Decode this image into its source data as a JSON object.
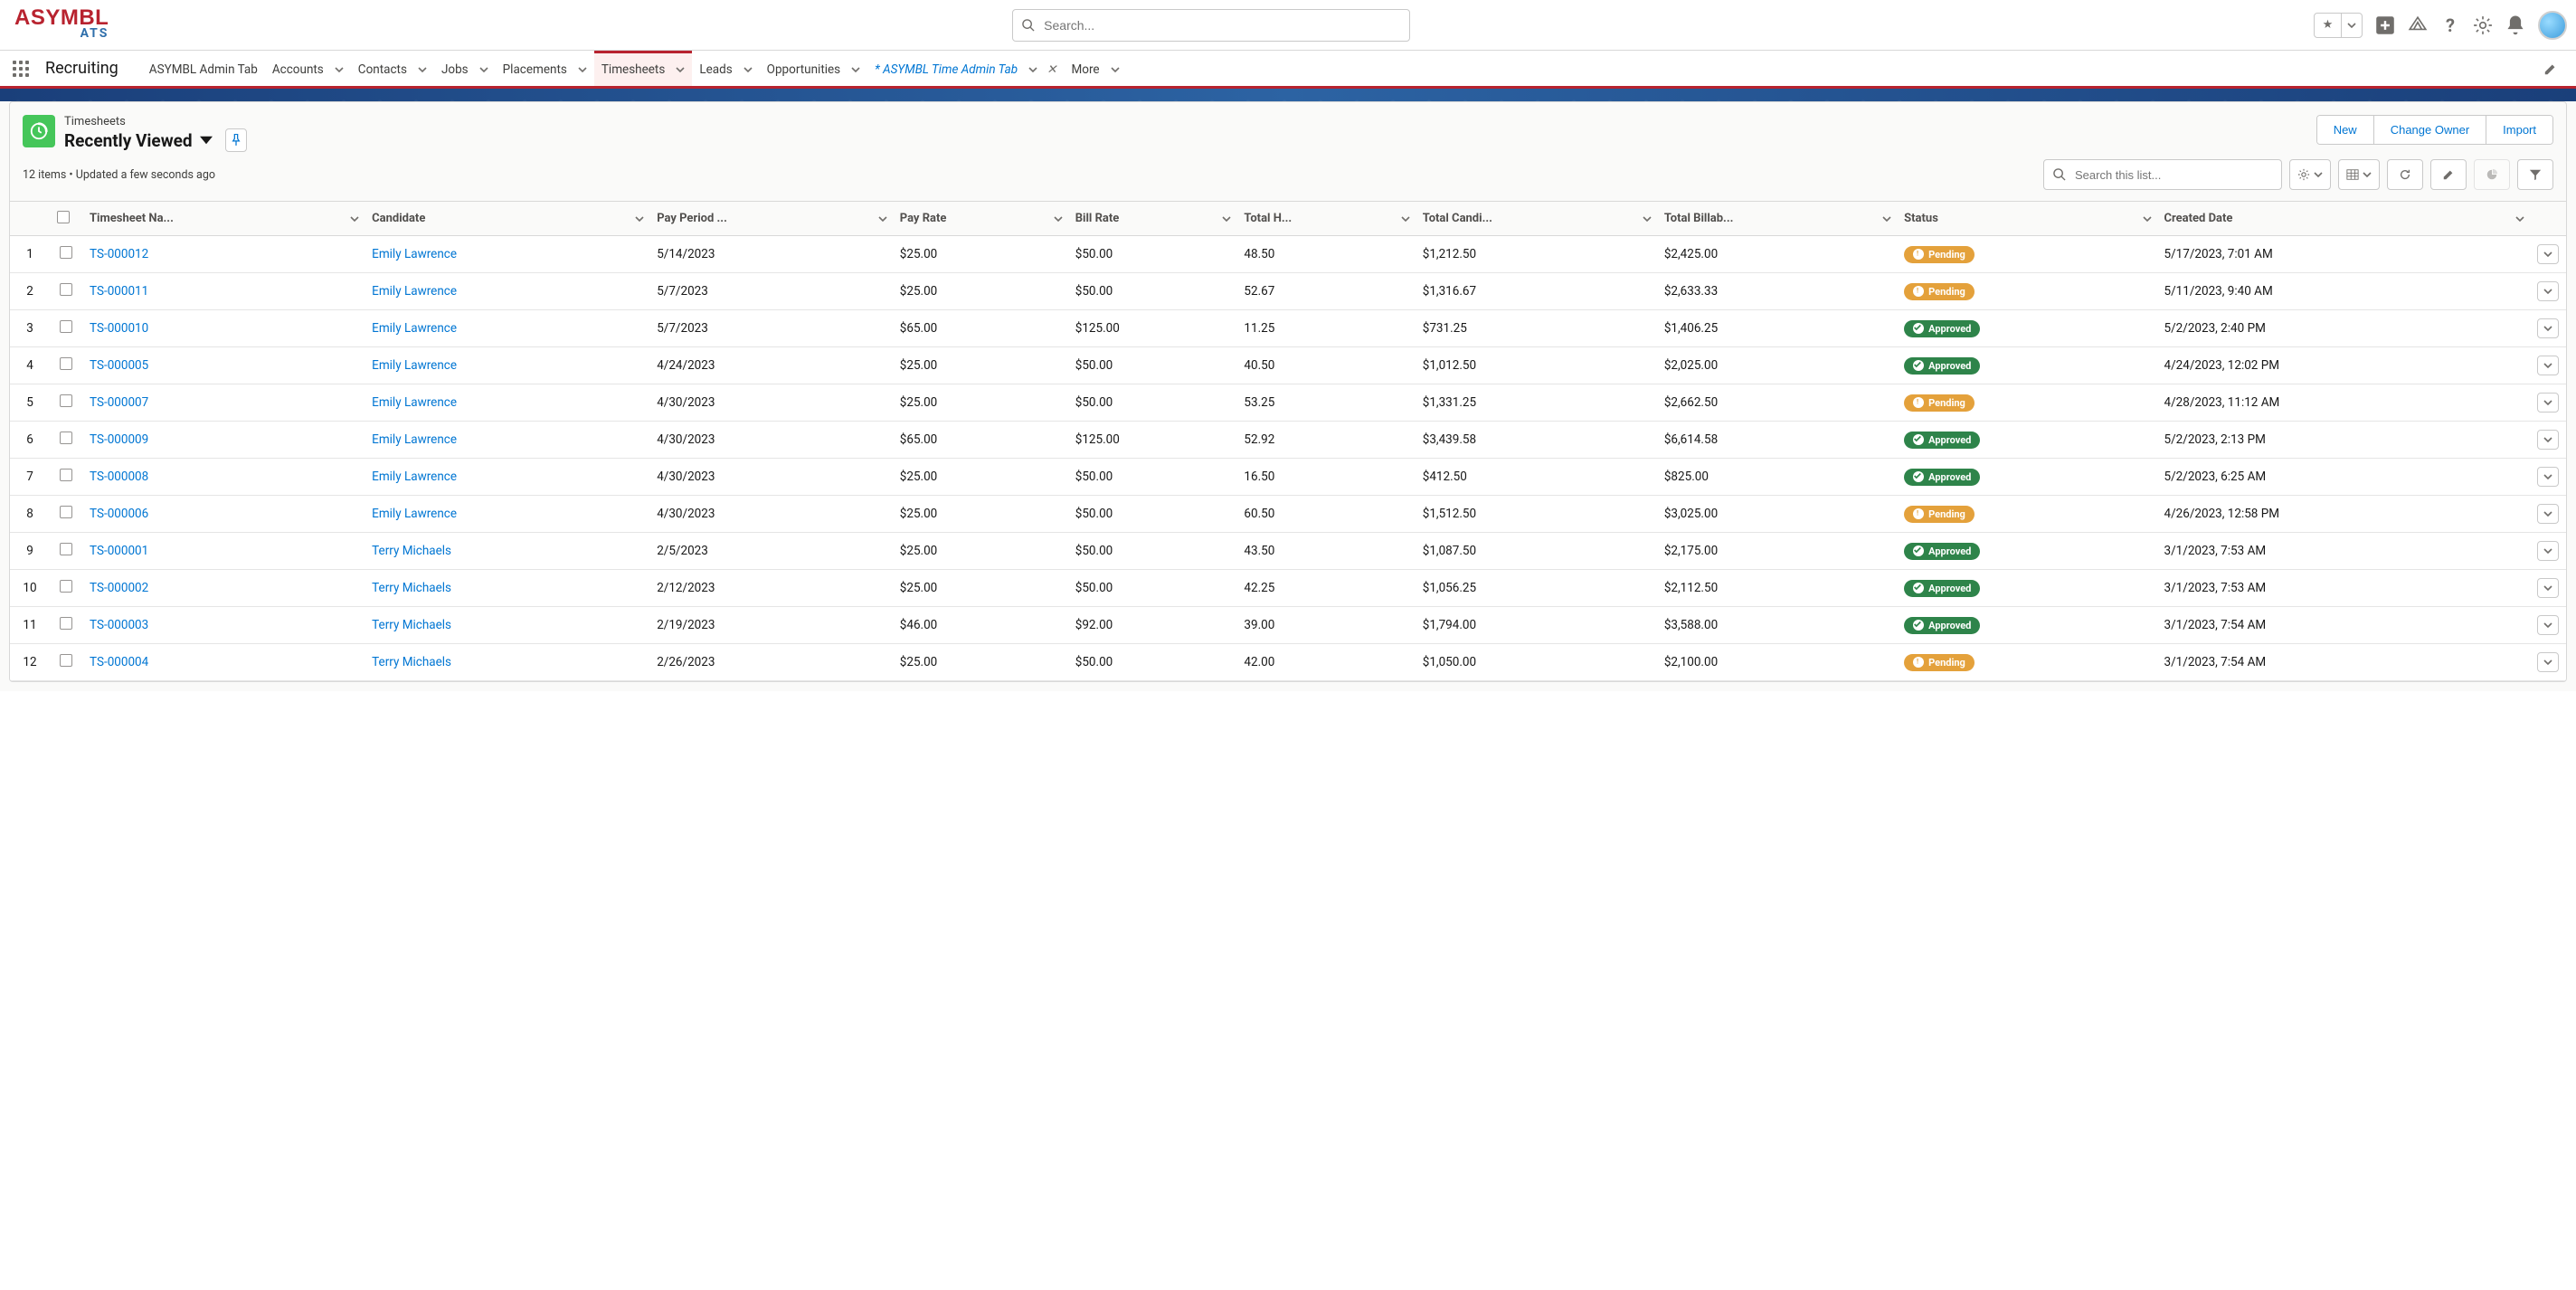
{
  "logo": {
    "main": "ASYMBL",
    "sub": "ATS"
  },
  "globalSearch": {
    "placeholder": "Search..."
  },
  "appName": "Recruiting",
  "navTabs": [
    {
      "label": "ASYMBL Admin Tab",
      "hasDropdown": false
    },
    {
      "label": "Accounts",
      "hasDropdown": true
    },
    {
      "label": "Contacts",
      "hasDropdown": true
    },
    {
      "label": "Jobs",
      "hasDropdown": true
    },
    {
      "label": "Placements",
      "hasDropdown": true
    },
    {
      "label": "Timesheets",
      "hasDropdown": true,
      "active": true
    },
    {
      "label": "Leads",
      "hasDropdown": true
    },
    {
      "label": "Opportunities",
      "hasDropdown": true
    },
    {
      "label": "* ASYMBL Time Admin Tab",
      "hasDropdown": true,
      "italic": true,
      "closable": true
    },
    {
      "label": "More",
      "hasDropdown": true
    }
  ],
  "listHeader": {
    "object": "Timesheets",
    "viewName": "Recently Viewed",
    "meta": "12 items • Updated a few seconds ago"
  },
  "actions": {
    "new": "New",
    "changeOwner": "Change Owner",
    "import": "Import"
  },
  "listSearch": {
    "placeholder": "Search this list..."
  },
  "columns": [
    "Timesheet Na...",
    "Candidate",
    "Pay Period ...",
    "Pay Rate",
    "Bill Rate",
    "Total H...",
    "Total Candi...",
    "Total Billab...",
    "Status",
    "Created Date"
  ],
  "rows": [
    {
      "n": "1",
      "name": "TS-000012",
      "candidate": "Emily Lawrence",
      "period": "5/14/2023",
      "pay": "$25.00",
      "bill": "$50.00",
      "hours": "48.50",
      "candTotal": "$1,212.50",
      "billTotal": "$2,425.00",
      "status": "Pending",
      "created": "5/17/2023, 7:01 AM"
    },
    {
      "n": "2",
      "name": "TS-000011",
      "candidate": "Emily Lawrence",
      "period": "5/7/2023",
      "pay": "$25.00",
      "bill": "$50.00",
      "hours": "52.67",
      "candTotal": "$1,316.67",
      "billTotal": "$2,633.33",
      "status": "Pending",
      "created": "5/11/2023, 9:40 AM"
    },
    {
      "n": "3",
      "name": "TS-000010",
      "candidate": "Emily Lawrence",
      "period": "5/7/2023",
      "pay": "$65.00",
      "bill": "$125.00",
      "hours": "11.25",
      "candTotal": "$731.25",
      "billTotal": "$1,406.25",
      "status": "Approved",
      "created": "5/2/2023, 2:40 PM"
    },
    {
      "n": "4",
      "name": "TS-000005",
      "candidate": "Emily Lawrence",
      "period": "4/24/2023",
      "pay": "$25.00",
      "bill": "$50.00",
      "hours": "40.50",
      "candTotal": "$1,012.50",
      "billTotal": "$2,025.00",
      "status": "Approved",
      "created": "4/24/2023, 12:02 PM"
    },
    {
      "n": "5",
      "name": "TS-000007",
      "candidate": "Emily Lawrence",
      "period": "4/30/2023",
      "pay": "$25.00",
      "bill": "$50.00",
      "hours": "53.25",
      "candTotal": "$1,331.25",
      "billTotal": "$2,662.50",
      "status": "Pending",
      "created": "4/28/2023, 11:12 AM"
    },
    {
      "n": "6",
      "name": "TS-000009",
      "candidate": "Emily Lawrence",
      "period": "4/30/2023",
      "pay": "$65.00",
      "bill": "$125.00",
      "hours": "52.92",
      "candTotal": "$3,439.58",
      "billTotal": "$6,614.58",
      "status": "Approved",
      "created": "5/2/2023, 2:13 PM"
    },
    {
      "n": "7",
      "name": "TS-000008",
      "candidate": "Emily Lawrence",
      "period": "4/30/2023",
      "pay": "$25.00",
      "bill": "$50.00",
      "hours": "16.50",
      "candTotal": "$412.50",
      "billTotal": "$825.00",
      "status": "Approved",
      "created": "5/2/2023, 6:25 AM"
    },
    {
      "n": "8",
      "name": "TS-000006",
      "candidate": "Emily Lawrence",
      "period": "4/30/2023",
      "pay": "$25.00",
      "bill": "$50.00",
      "hours": "60.50",
      "candTotal": "$1,512.50",
      "billTotal": "$3,025.00",
      "status": "Pending",
      "created": "4/26/2023, 12:58 PM"
    },
    {
      "n": "9",
      "name": "TS-000001",
      "candidate": "Terry Michaels",
      "period": "2/5/2023",
      "pay": "$25.00",
      "bill": "$50.00",
      "hours": "43.50",
      "candTotal": "$1,087.50",
      "billTotal": "$2,175.00",
      "status": "Approved",
      "created": "3/1/2023, 7:53 AM"
    },
    {
      "n": "10",
      "name": "TS-000002",
      "candidate": "Terry Michaels",
      "period": "2/12/2023",
      "pay": "$25.00",
      "bill": "$50.00",
      "hours": "42.25",
      "candTotal": "$1,056.25",
      "billTotal": "$2,112.50",
      "status": "Approved",
      "created": "3/1/2023, 7:53 AM"
    },
    {
      "n": "11",
      "name": "TS-000003",
      "candidate": "Terry Michaels",
      "period": "2/19/2023",
      "pay": "$46.00",
      "bill": "$92.00",
      "hours": "39.00",
      "candTotal": "$1,794.00",
      "billTotal": "$3,588.00",
      "status": "Approved",
      "created": "3/1/2023, 7:54 AM"
    },
    {
      "n": "12",
      "name": "TS-000004",
      "candidate": "Terry Michaels",
      "period": "2/26/2023",
      "pay": "$25.00",
      "bill": "$50.00",
      "hours": "42.00",
      "candTotal": "$1,050.00",
      "billTotal": "$2,100.00",
      "status": "Pending",
      "created": "3/1/2023, 7:54 AM"
    }
  ]
}
